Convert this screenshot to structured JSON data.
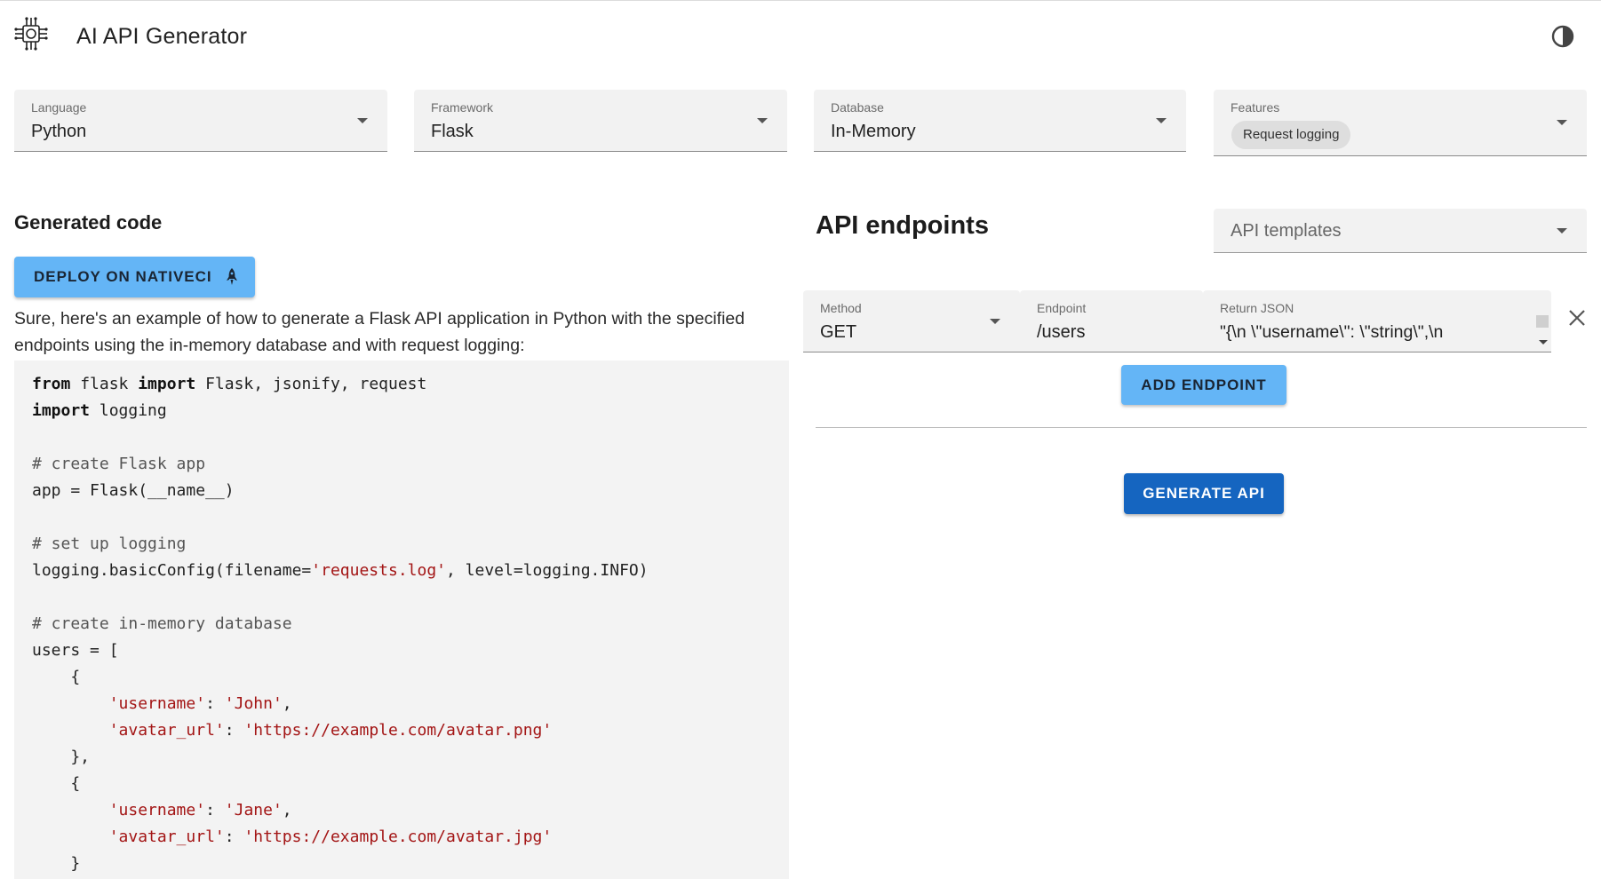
{
  "app": {
    "title": "AI API Generator",
    "logo_icon": "ai-chip-icon",
    "theme_toggle_icon": "contrast-icon"
  },
  "config": {
    "language": {
      "label": "Language",
      "value": "Python"
    },
    "framework": {
      "label": "Framework",
      "value": "Flask"
    },
    "database": {
      "label": "Database",
      "value": "In-Memory"
    },
    "features": {
      "label": "Features",
      "chips": [
        "Request logging"
      ]
    }
  },
  "generated": {
    "heading": "Generated code",
    "deploy_label": "DEPLOY ON NATIVECI",
    "deploy_icon": "rocket-icon",
    "intro": "Sure, here's an example of how to generate a Flask API application in Python with the specified endpoints using the in-memory database and with request logging:",
    "code_lines": [
      [
        {
          "t": "from",
          "c": "kw"
        },
        {
          "t": " flask "
        },
        {
          "t": "import",
          "c": "kw"
        },
        {
          "t": " Flask, jsonify, request"
        }
      ],
      [
        {
          "t": "import",
          "c": "kw"
        },
        {
          "t": " logging"
        }
      ],
      [],
      [
        {
          "t": "# create Flask app",
          "c": "cm"
        }
      ],
      [
        {
          "t": "app = Flask(__name__)"
        }
      ],
      [],
      [
        {
          "t": "# set up logging",
          "c": "cm"
        }
      ],
      [
        {
          "t": "logging.basicConfig(filename="
        },
        {
          "t": "'requests.log'",
          "c": "st"
        },
        {
          "t": ", level=logging.INFO)"
        }
      ],
      [],
      [
        {
          "t": "# create in-memory database",
          "c": "cm"
        }
      ],
      [
        {
          "t": "users = ["
        }
      ],
      [
        {
          "t": "    {"
        }
      ],
      [
        {
          "t": "        "
        },
        {
          "t": "'username'",
          "c": "st"
        },
        {
          "t": ": "
        },
        {
          "t": "'John'",
          "c": "st"
        },
        {
          "t": ","
        }
      ],
      [
        {
          "t": "        "
        },
        {
          "t": "'avatar_url'",
          "c": "st"
        },
        {
          "t": ": "
        },
        {
          "t": "'https://example.com/avatar.png'",
          "c": "st"
        }
      ],
      [
        {
          "t": "    },"
        }
      ],
      [
        {
          "t": "    {"
        }
      ],
      [
        {
          "t": "        "
        },
        {
          "t": "'username'",
          "c": "st"
        },
        {
          "t": ": "
        },
        {
          "t": "'Jane'",
          "c": "st"
        },
        {
          "t": ","
        }
      ],
      [
        {
          "t": "        "
        },
        {
          "t": "'avatar_url'",
          "c": "st"
        },
        {
          "t": ": "
        },
        {
          "t": "'https://example.com/avatar.jpg'",
          "c": "st"
        }
      ],
      [
        {
          "t": "    }"
        }
      ]
    ]
  },
  "api": {
    "heading": "API endpoints",
    "templates_placeholder": "API templates",
    "endpoint": {
      "method_label": "Method",
      "method_value": "GET",
      "endpoint_label": "Endpoint",
      "endpoint_value": "/users",
      "json_label": "Return JSON",
      "json_value": "\"{\\n  \\\"username\\\": \\\"string\\\",\\n"
    },
    "remove_icon": "close-icon",
    "add_label": "ADD ENDPOINT",
    "generate_label": "GENERATE API"
  },
  "colors": {
    "accent_light": "#64b5f6",
    "accent_dark": "#1565c0",
    "field_bg": "#f2f2f2",
    "code_bg": "#f3f3f3",
    "code_string": "#a31515"
  }
}
